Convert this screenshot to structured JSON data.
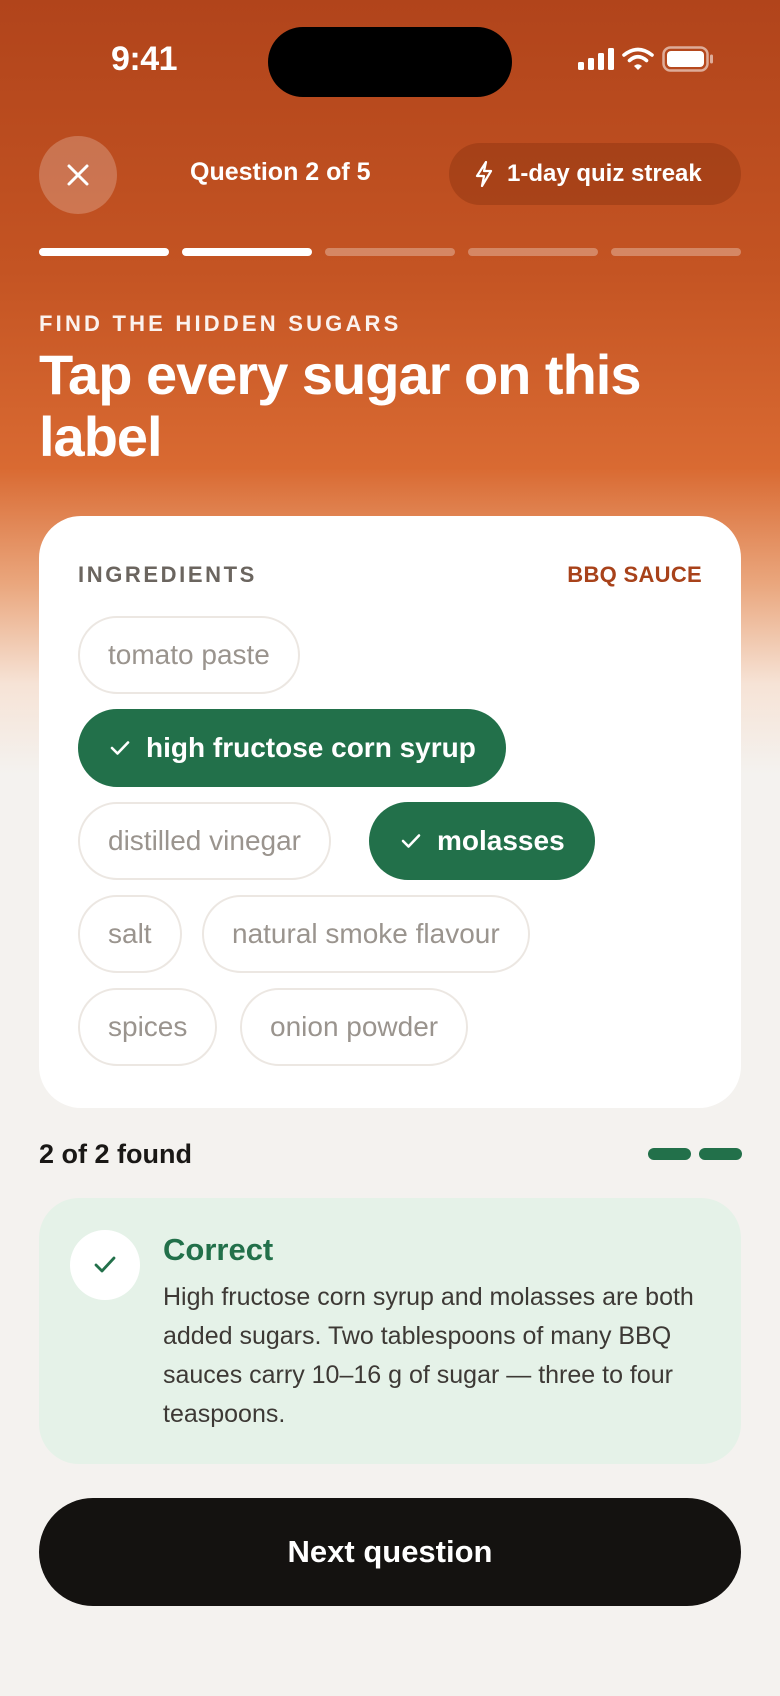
{
  "status_bar": {
    "time": "9:41"
  },
  "header": {
    "question_counter": "Question 2 of 5",
    "streak_label": "1-day quiz streak",
    "progress": {
      "total": 5,
      "completed": 2
    }
  },
  "prompt": {
    "eyebrow": "FIND THE HIDDEN SUGARS",
    "headline": "Tap every sugar on this label"
  },
  "card": {
    "label": "INGREDIENTS",
    "product": "BBQ SAUCE",
    "ingredients": [
      {
        "name": "tomato paste",
        "selected": false
      },
      {
        "name": "high fructose corn syrup",
        "selected": true
      },
      {
        "name": "distilled vinegar",
        "selected": false
      },
      {
        "name": "molasses",
        "selected": true
      },
      {
        "name": "salt",
        "selected": false
      },
      {
        "name": "natural smoke flavour",
        "selected": false
      },
      {
        "name": "spices",
        "selected": false
      },
      {
        "name": "onion powder",
        "selected": false
      }
    ]
  },
  "result": {
    "found_text": "2 of 2 found",
    "found": 2,
    "total": 2
  },
  "feedback": {
    "title": "Correct",
    "body": "High fructose corn syrup and molasses are both added sugars. Two tablespoons of many BBQ sauces carry 10–16 g of sugar — three to four teaspoons."
  },
  "footer": {
    "next_label": "Next question"
  },
  "colors": {
    "accent_orange": "#c45423",
    "success_green": "#22704a",
    "feedback_bg": "#e5f2e8",
    "button_dark": "#141210"
  },
  "icons": {
    "close": "close-icon",
    "streak": "lightning-icon",
    "check": "check-icon",
    "signal": "signal-icon",
    "wifi": "wifi-icon",
    "battery": "battery-icon"
  }
}
